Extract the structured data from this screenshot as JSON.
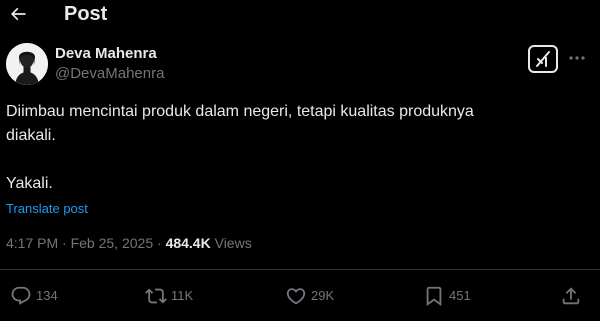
{
  "header": {
    "title": "Post",
    "back_icon": "arrow-left-icon"
  },
  "author": {
    "name": "Deva Mahenra",
    "handle": "@DevaMahenra"
  },
  "post": {
    "text": "Diimbau mencintai produk dalam negeri, tetapi kualitas produknya\ndiakali.\n\nYakali.",
    "translate_label": "Translate post",
    "time": "4:17 PM",
    "date": "Feb 25, 2025",
    "separator": "·",
    "views": "484.4K",
    "views_label": "Views"
  },
  "actions": {
    "replies": "134",
    "reposts": "11K",
    "likes": "29K",
    "bookmarks": "451"
  },
  "colors": {
    "background": "#000000",
    "text": "#e7e9ea",
    "muted": "#71767b",
    "link": "#1d9bf0",
    "divider": "#2f3336"
  }
}
